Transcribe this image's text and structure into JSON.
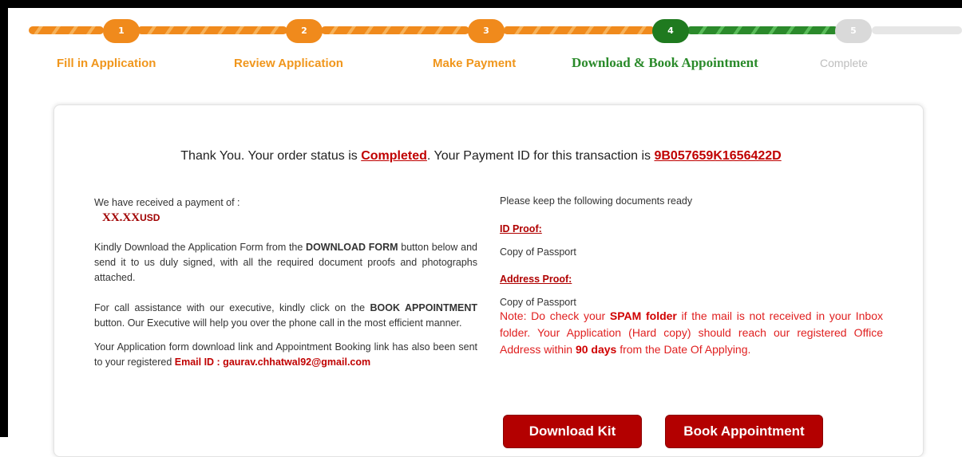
{
  "steps": [
    {
      "number": "1",
      "label": "Fill in Application"
    },
    {
      "number": "2",
      "label": "Review Application"
    },
    {
      "number": "3",
      "label": "Make Payment"
    },
    {
      "number": "4",
      "label": "Download & Book Appointment"
    },
    {
      "number": "5",
      "label": "Complete"
    }
  ],
  "thanks": {
    "prefix": "Thank You. Your order status is ",
    "status": "Completed",
    "middle": ". Your Payment ID for this transaction is ",
    "payment_id": "9B057659K1656422D"
  },
  "left": {
    "received": "We have received a payment of :",
    "amount": "XX.XX",
    "currency": "USD",
    "download_p1": "Kindly Download the Application Form from the ",
    "download_bold": "DOWNLOAD FORM",
    "download_p2": " button below and send it to us duly signed, with all the required document proofs and photographs attached.",
    "call_p1": "For call assistance with our executive, kindly click on the ",
    "call_bold": "BOOK APPOINTMENT",
    "call_p2": " button. Our Executive will help you over the phone call in the most efficient manner.",
    "link_text": "Your Application form download link and Appointment Booking link has also been sent to your registered ",
    "email_label": "Email ID : gaurav.chhatwal92@gmail.com"
  },
  "right": {
    "intro": "Please keep the following documents ready",
    "id_title": "ID Proof:",
    "id_value": "Copy of Passport",
    "address_title": "Address Proof:",
    "address_value": "Copy of Passport",
    "note_p1": "Note: Do check your ",
    "note_bold1": "SPAM folder",
    "note_p2": " if the mail is not received in your Inbox folder. Your Application (Hard copy) should reach our registered Office Address within ",
    "note_bold2": "90 days",
    "note_p3": " from the Date Of Applying."
  },
  "buttons": {
    "download": "Download Kit",
    "book": "Book Appointment"
  }
}
